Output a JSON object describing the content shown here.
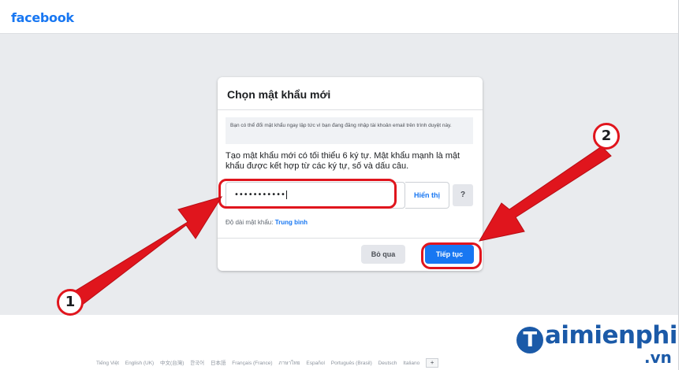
{
  "header": {
    "logo_text": "facebook"
  },
  "dialog": {
    "title": "Chọn mật khẩu mới",
    "info_text": "Bạn có thể đổi mật khẩu ngay lập tức vì bạn đang đăng nhập tài khoản email trên trình duyệt này.",
    "description": "Tạo mật khẩu mới có tối thiểu 6 ký tự. Mật khẩu mạnh là mật khẩu được kết hợp từ các ký tự, số và dấu câu.",
    "password_value": "•••••••••••",
    "show_label": "Hiển thị",
    "help_label": "?",
    "strength_label": "Độ dài mật khẩu:",
    "strength_value": "Trung bình",
    "skip_label": "Bỏ qua",
    "continue_label": "Tiếp tục"
  },
  "annotations": {
    "badge1": "1",
    "badge2": "2",
    "color": "#e0151d"
  },
  "footer": {
    "languages": [
      "Tiếng Việt",
      "English (UK)",
      "中文(台灣)",
      "한국어",
      "日本語",
      "Français (France)",
      "ภาษาไทย",
      "Español",
      "Português (Brasil)",
      "Deutsch",
      "Italiano"
    ],
    "plus_label": "+"
  },
  "watermark": {
    "initial": "T",
    "rest": "aimienphi",
    "suffix": ".vn"
  },
  "colors": {
    "brand": "#1877f2",
    "background": "#e9ebee",
    "annotation": "#e0151d"
  },
  "icons": {
    "help": "question-icon",
    "plus": "plus-icon"
  }
}
